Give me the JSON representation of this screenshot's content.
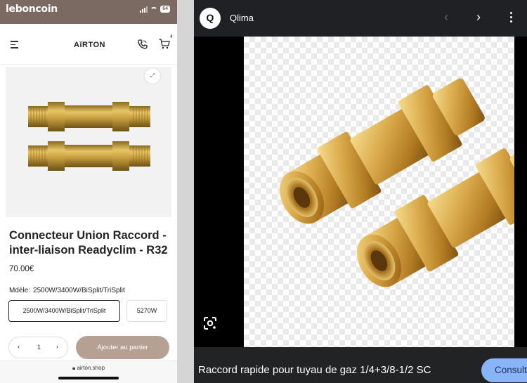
{
  "phone": {
    "app_name": "leboncoin",
    "status": {
      "battery": "64"
    },
    "header": {
      "brand": "AĭRTON",
      "cart_count": "4"
    },
    "product": {
      "title": "Connecteur Union Raccord - inter-liaison Readyclim - R32",
      "price": "70.00€",
      "model_label": "Mdèle:",
      "model_value": "2500W/3400W/BiSplit/TriSplit",
      "options": [
        "2500W/3400W/BiSplit/TriSplit",
        "5270W"
      ],
      "quantity": "1",
      "add_to_cart": "Ajouter au panier"
    },
    "url": "airton.shop"
  },
  "viewer": {
    "source_initial": "Q",
    "source_name": "Qlima",
    "caption": "Raccord rapide pour tuyau de gaz 1/4+3/8-1/2 SC",
    "action_button": "Consulter"
  },
  "colors": {
    "leboncoin_bar": "#7a6a62",
    "add_to_cart": "#b6a093",
    "viewer_background": "#202124",
    "consult_button": "#8ab4f8",
    "brass": "#c9a043"
  }
}
